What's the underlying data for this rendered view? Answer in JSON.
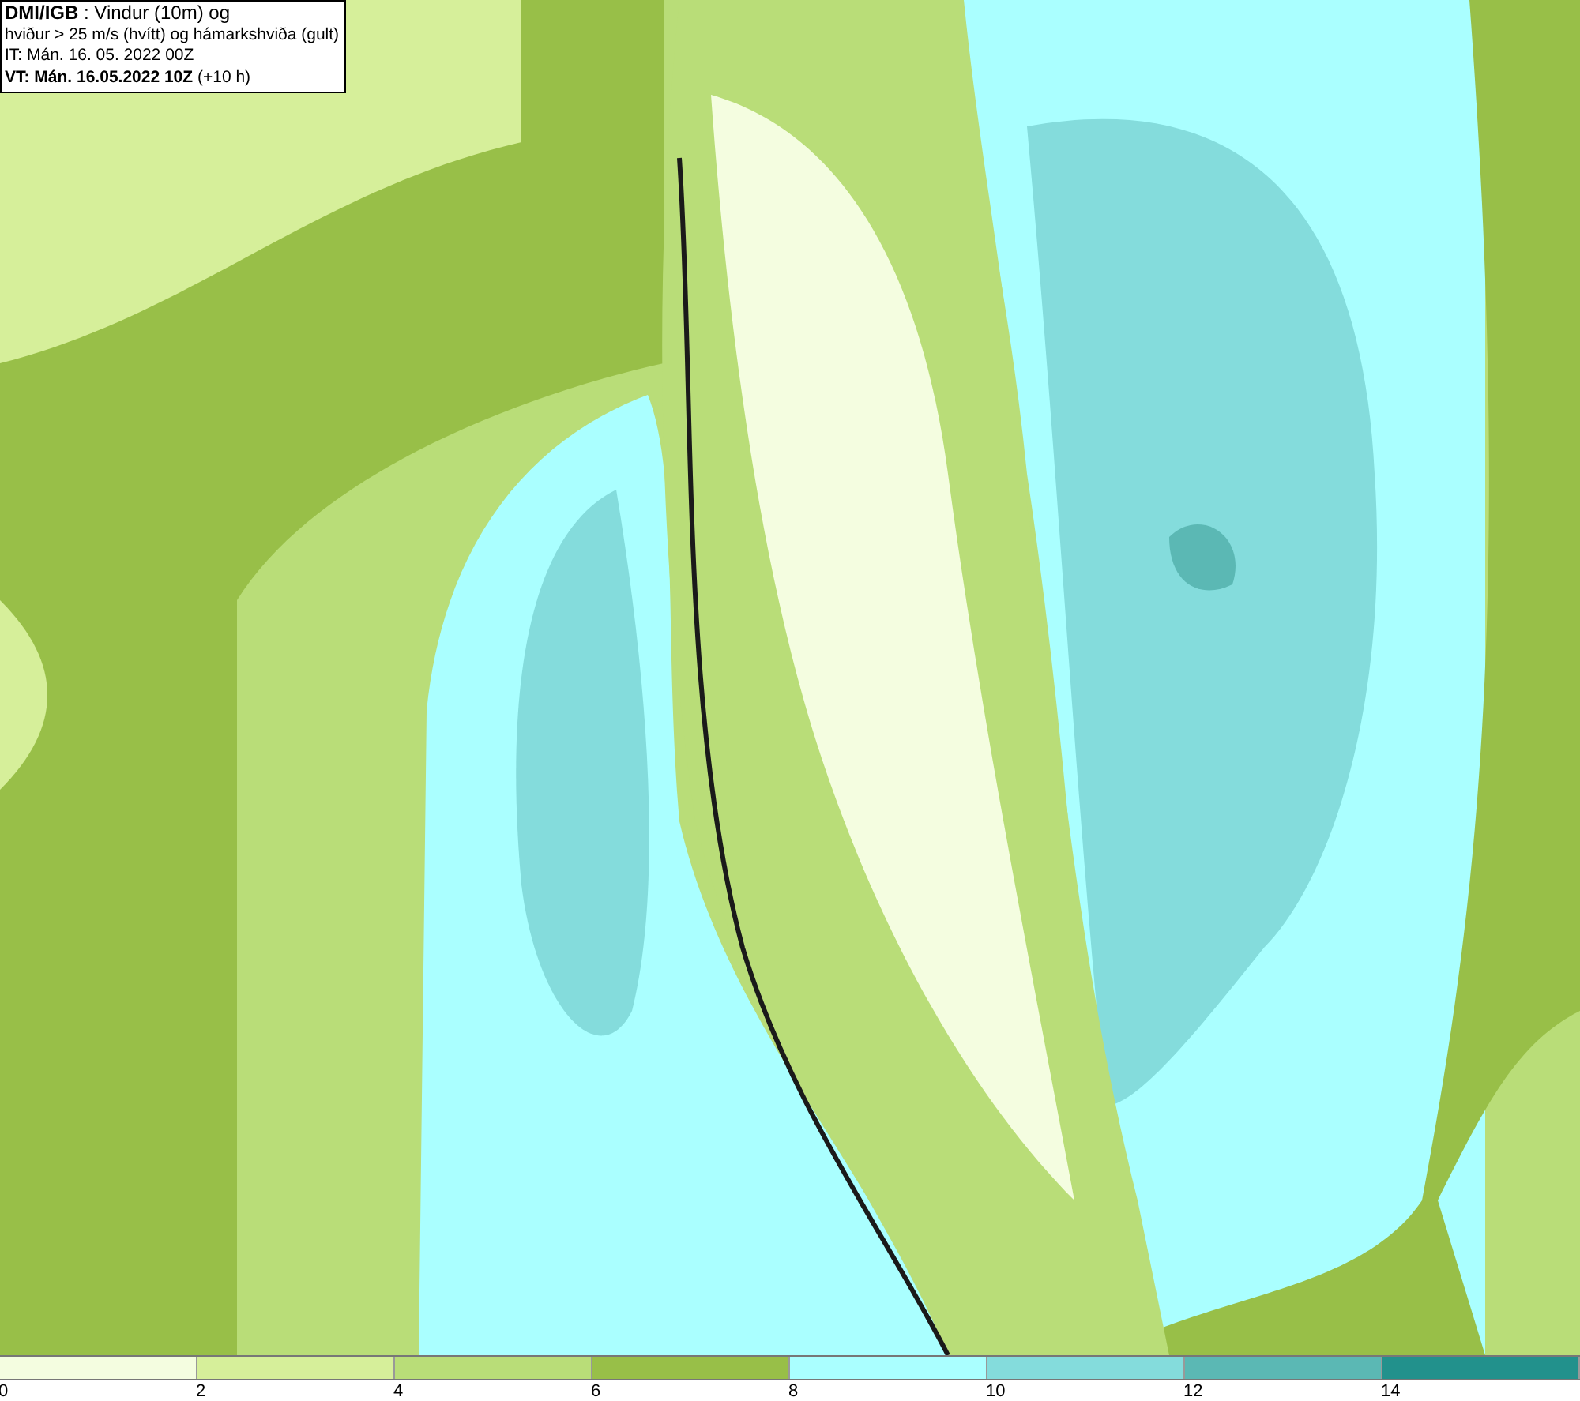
{
  "info_box": {
    "lines": [
      "**DMI/IGB** : Vindur (10m) og",
      "hviður > 25 m/s (hvítt) og hámarkshviða (gult)",
      "IT: Mán. 16. 05. 2022 00Z",
      "**VT: Mán. 16.05.2022 10Z** (+10 h)"
    ]
  },
  "legend": {
    "segments": [
      {
        "color": "#f4fde0",
        "label": "0"
      },
      {
        "color": "#d6ef9a",
        "label": "2"
      },
      {
        "color": "#b9dd78",
        "label": "4"
      },
      {
        "color": "#98bf48",
        "label": "6"
      },
      {
        "color": "#aaffff",
        "label": "8"
      },
      {
        "color": "#84dcdc",
        "label": "10"
      },
      {
        "color": "#5bb8b4",
        "label": "12"
      },
      {
        "color": "#22918c",
        "label": "14"
      }
    ]
  }
}
